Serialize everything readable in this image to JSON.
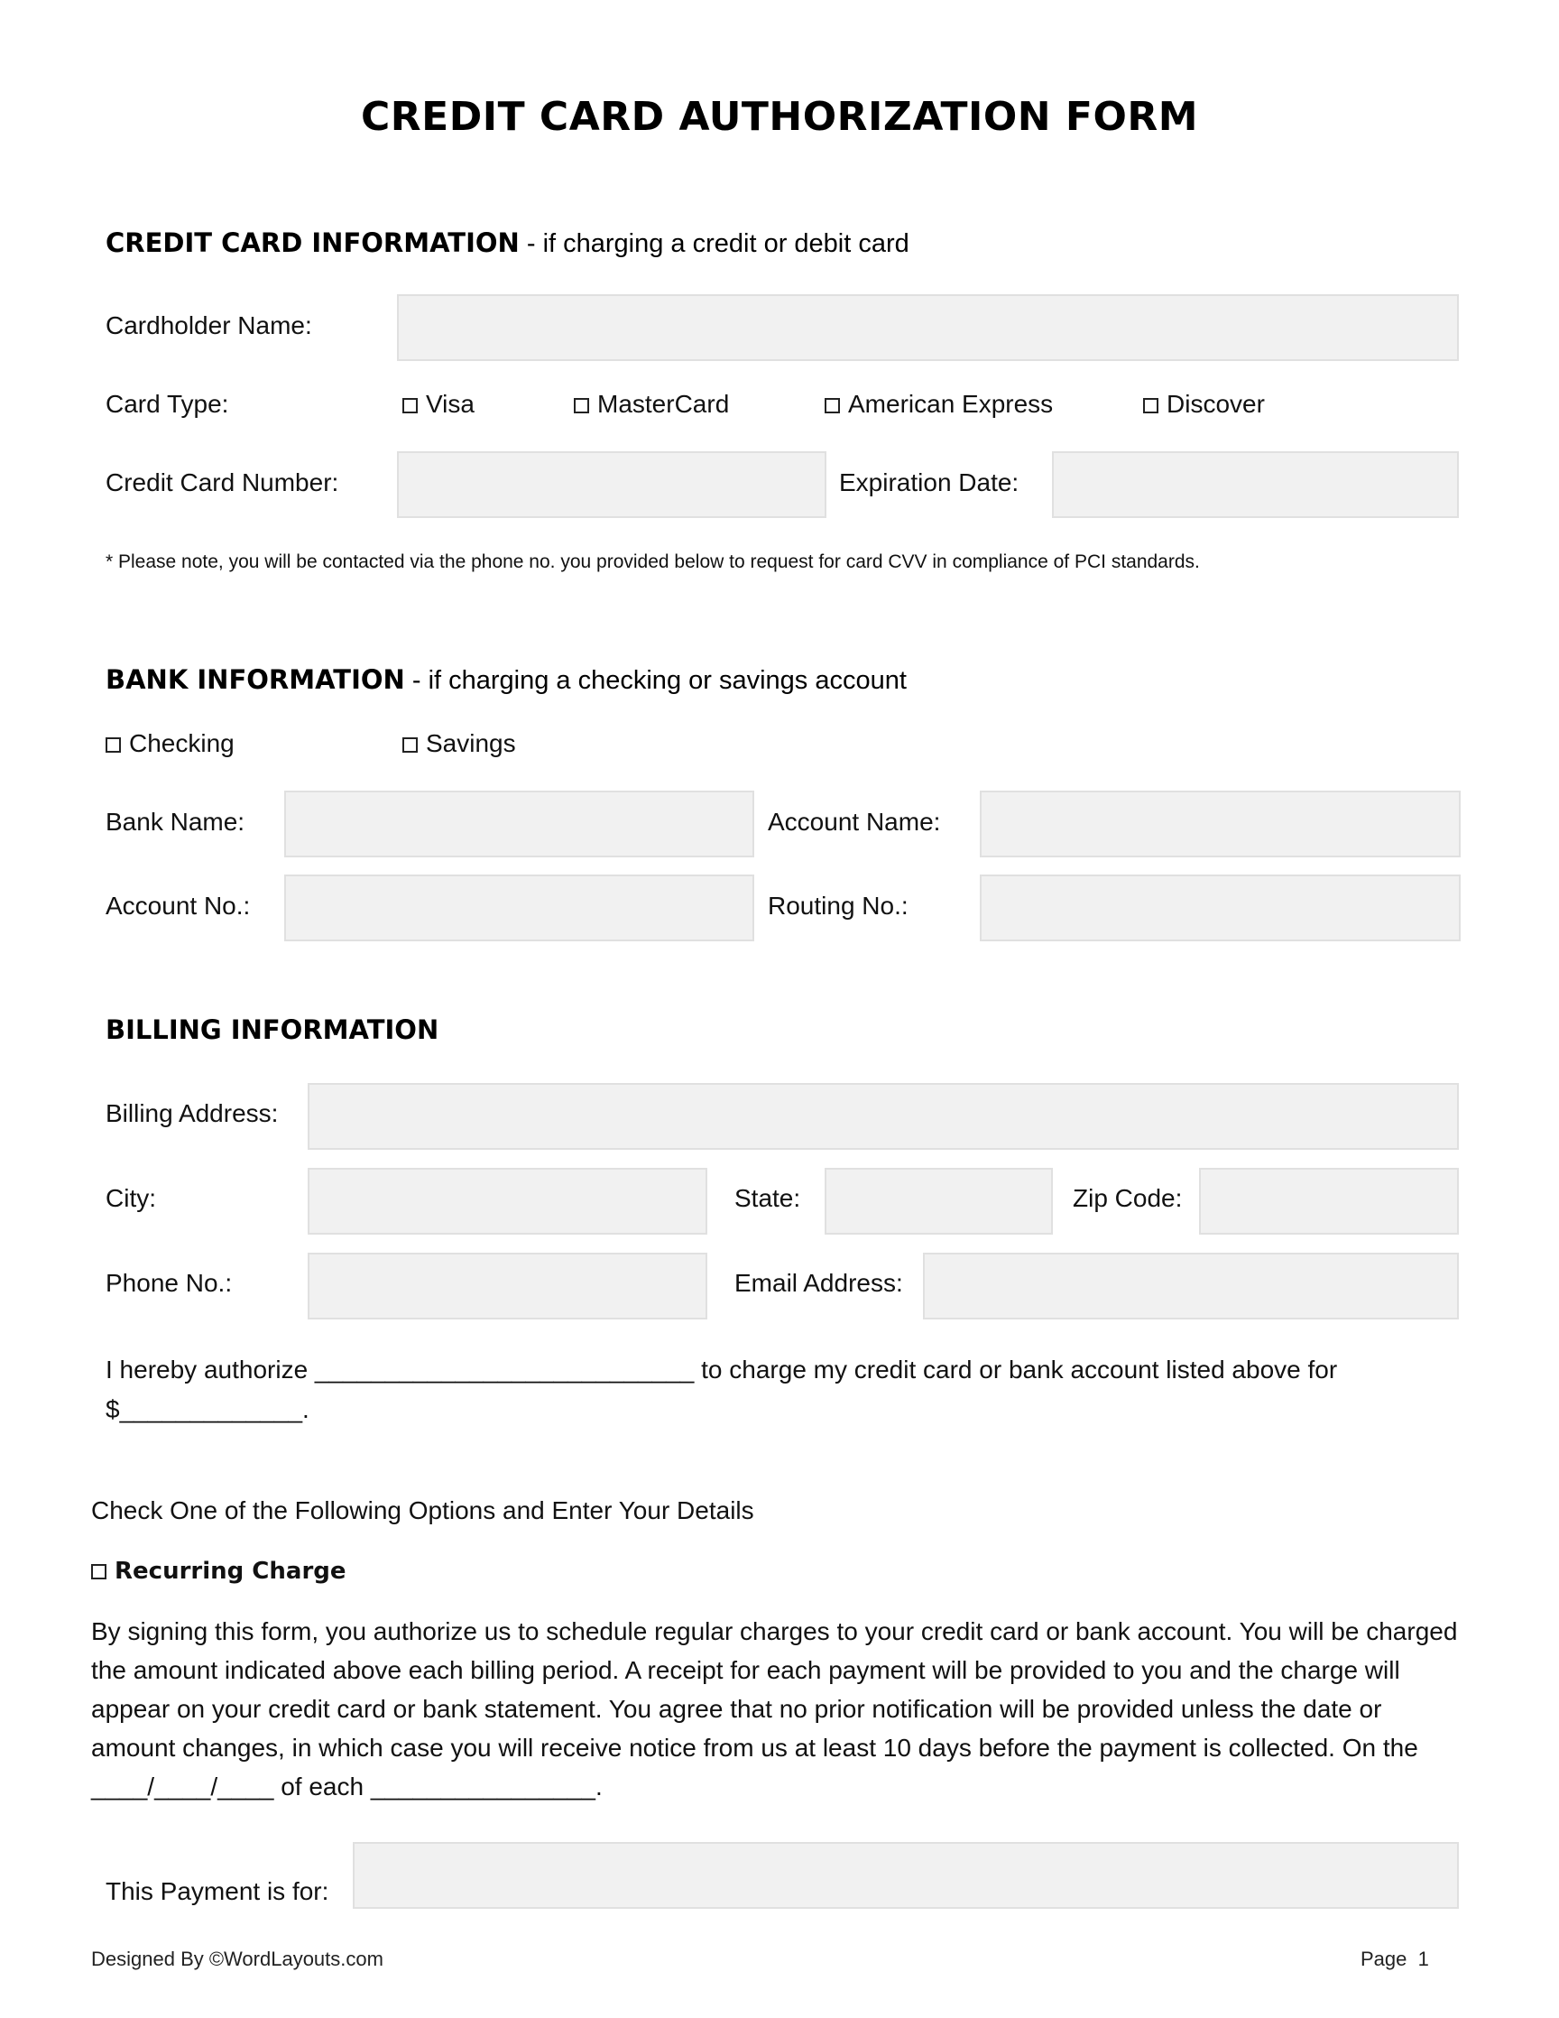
{
  "title": "CREDIT CARD AUTHORIZATION FORM",
  "credit_card": {
    "heading": "CREDIT CARD INFORMATION",
    "subheading": " - if charging a credit or debit card",
    "cardholder_label": "Cardholder Name:",
    "cardholder_value": "",
    "card_type_label": "Card Type:",
    "card_types": [
      {
        "label": "Visa",
        "checked": false
      },
      {
        "label": "MasterCard",
        "checked": false
      },
      {
        "label": "American Express",
        "checked": false
      },
      {
        "label": "Discover",
        "checked": false
      }
    ],
    "card_number_label": "Credit Card Number:",
    "card_number_value": "",
    "expiration_label": "Expiration Date:",
    "expiration_value": "",
    "note": "* Please note, you will be contacted via the phone no. you provided below to request for card CVV in compliance of PCI standards."
  },
  "bank": {
    "heading": "BANK INFORMATION",
    "subheading": " - if charging a checking or savings account",
    "account_types": [
      {
        "label": "Checking",
        "checked": false
      },
      {
        "label": "Savings",
        "checked": false
      }
    ],
    "bank_name_label": "Bank Name:",
    "bank_name_value": "",
    "account_name_label": "Account Name:",
    "account_name_value": "",
    "account_no_label": "Account No.:",
    "account_no_value": "",
    "routing_no_label": "Routing No.:",
    "routing_no_value": ""
  },
  "billing": {
    "heading": "BILLING INFORMATION",
    "address_label": "Billing Address:",
    "address_value": "",
    "city_label": "City:",
    "city_value": "",
    "state_label": "State:",
    "state_value": "",
    "zip_label": "Zip Code:",
    "zip_value": "",
    "phone_label": "Phone No.:",
    "phone_value": "",
    "email_label": "Email Address:",
    "email_value": ""
  },
  "authorization": {
    "line1": "I hereby authorize ___________________________ to charge my credit card or bank account listed above for",
    "line2": "$_____________."
  },
  "options": {
    "instruction": "Check One of the Following Options and Enter Your Details",
    "recurring_label": "Recurring Charge",
    "recurring_checked": false,
    "recurring_text": "By signing this form, you authorize us to schedule regular charges to your credit card or bank account. You will be charged the amount indicated above each billing period. A receipt for each payment will be provided to you and the charge will appear on your credit card or bank statement. You agree that no prior notification will be provided unless the date or amount changes, in which case you will receive notice from us at least 10 days before the payment is collected. On the ____/____/____ of each ________________."
  },
  "payment_for": {
    "label": "This Payment is for:",
    "value": ""
  },
  "footer": {
    "designed_by": "Designed By ©WordLayouts.com",
    "page_label": "Page  1"
  }
}
